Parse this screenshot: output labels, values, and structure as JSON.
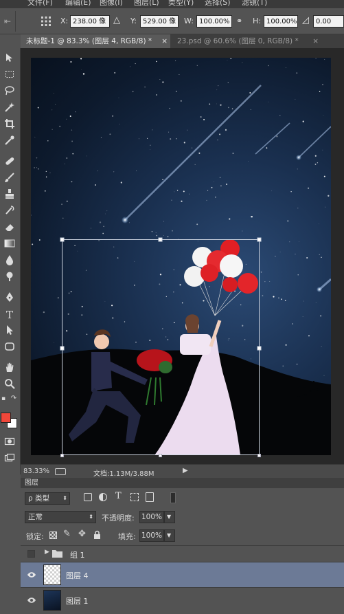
{
  "menubar": {
    "items": [
      "文件(F)",
      "编辑(E)",
      "图像(I)",
      "图层(L)",
      "类型(Y)",
      "选择(S)",
      "滤镜(T)"
    ]
  },
  "options": {
    "x_label": "X:",
    "x_value": "238.00 像",
    "y_label": "Y:",
    "y_value": "529.00 像",
    "w_label": "W:",
    "w_value": "100.00%",
    "h_label": "H:",
    "h_value": "100.00%",
    "angle_value": "0.00"
  },
  "tabs": [
    {
      "label": "未标题-1 @ 83.3% (图层 4, RGB/8) *",
      "close": "×"
    },
    {
      "label": "23.psd @ 60.6% (图层 0, RGB/8) *",
      "close": "×"
    }
  ],
  "status": {
    "zoom": "83.33%",
    "doc_info": "文档:1.13M/3.88M"
  },
  "layers_panel": {
    "title": "图层",
    "filter_label": "ρ 类型",
    "blend_mode": "正常",
    "opacity_label": "不透明度:",
    "opacity_value": "100%",
    "lock_label": "锁定:",
    "fill_label": "填充:",
    "fill_value": "100%",
    "layers": [
      {
        "name": "组 1",
        "type": "group",
        "visible": false,
        "selected": false
      },
      {
        "name": "图层 4",
        "type": "layer",
        "visible": true,
        "selected": true
      },
      {
        "name": "图层 1",
        "type": "layer",
        "visible": true,
        "selected": false
      }
    ]
  },
  "colors": {
    "foreground": "#f0473a",
    "background": "#ffffff",
    "selected_layer": "#6c7a96",
    "canvas_sky": "#1a3050"
  },
  "icons": [
    "move-tool-icon",
    "marquee-tool-icon",
    "lasso-tool-icon",
    "magic-wand-icon",
    "crop-tool-icon",
    "eyedropper-icon",
    "healing-brush-icon",
    "brush-tool-icon",
    "stamp-tool-icon",
    "history-brush-icon",
    "eraser-icon",
    "gradient-tool-icon",
    "blur-tool-icon",
    "dodge-tool-icon",
    "pen-tool-icon",
    "type-tool-icon",
    "path-select-icon",
    "shape-tool-icon",
    "hand-tool-icon",
    "zoom-tool-icon",
    "quick-mask-icon",
    "screen-mode-icon",
    "eye-icon",
    "folder-icon",
    "lock-icon"
  ]
}
